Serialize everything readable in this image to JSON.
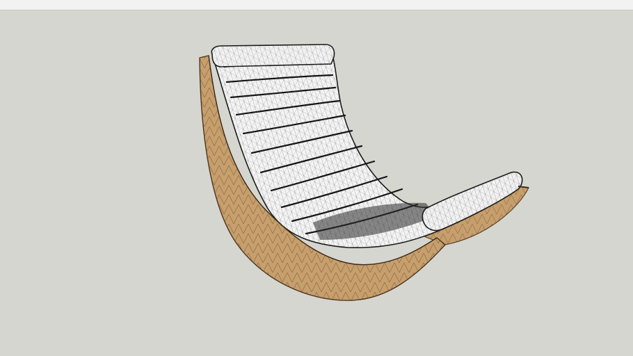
{
  "viewport": {
    "background": "#d6d6d0",
    "top_strip_color": "#f2f2f2"
  },
  "model": {
    "subject": "rocking-lounge-chair-wireframe",
    "frame_color": "#c79f6c",
    "frame_edge_color": "#5c4329",
    "cushion_fill": "#f4f4f4",
    "wire_color": "#1b1b1b",
    "cushion_ridge_count": 11
  }
}
